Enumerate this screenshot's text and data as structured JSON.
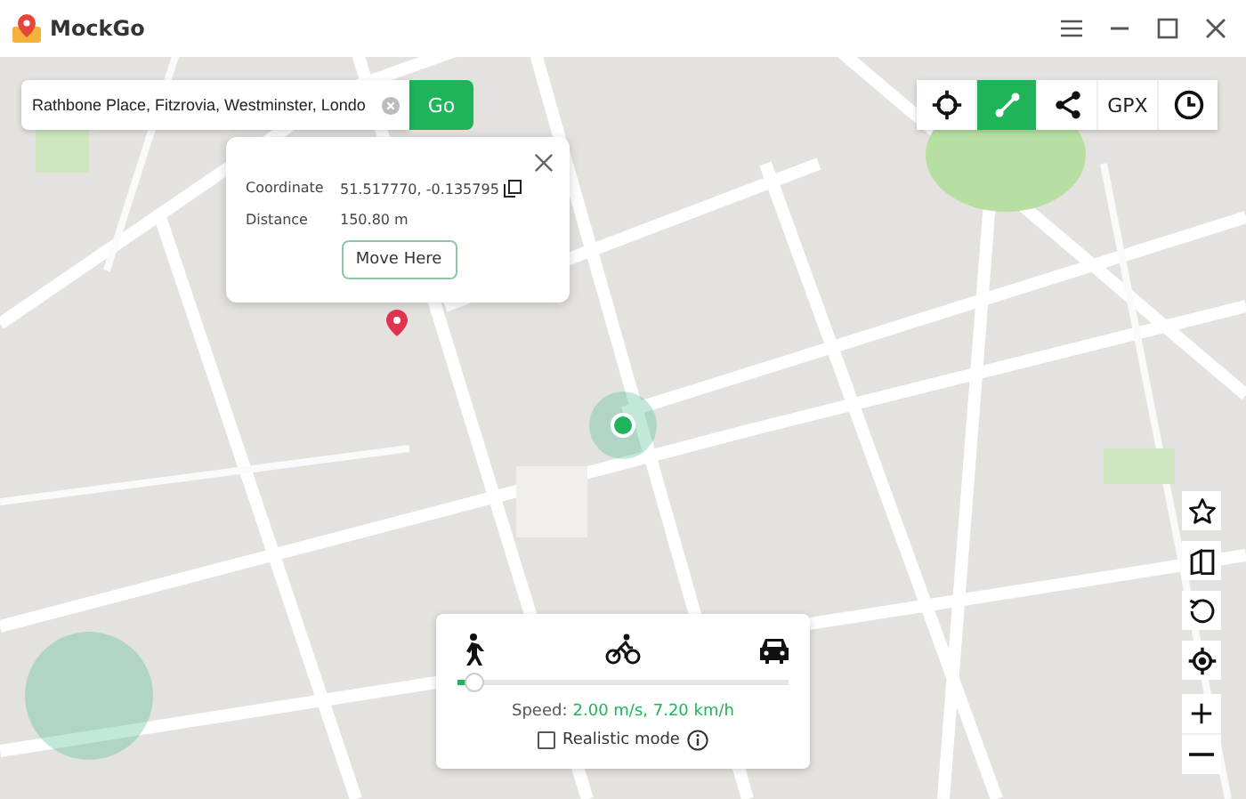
{
  "window": {
    "title": "MockGo"
  },
  "search": {
    "value": "Rathbone Place, Fitzrovia, Westminster, Londo",
    "button": "Go"
  },
  "toolbar": [
    {
      "kind": "crosshair",
      "selected": false
    },
    {
      "kind": "route",
      "selected": true
    },
    {
      "kind": "share",
      "selected": false
    },
    {
      "kind": "text",
      "label": "GPX",
      "selected": false
    },
    {
      "kind": "clock",
      "selected": false
    }
  ],
  "popup": {
    "rows": [
      {
        "label": "Coordinate",
        "value": "51.517770, -0.135795",
        "copy": true
      },
      {
        "label": "Distance",
        "value": "150.80 m",
        "copy": false
      }
    ],
    "button": "Move Here"
  },
  "speed_panel": {
    "modes": [
      {
        "kind": "walk"
      },
      {
        "kind": "bike"
      },
      {
        "kind": "car"
      }
    ],
    "level": 0.05,
    "speed_label": "Speed:",
    "speed_value": "2.00 m/s, 7.20 km/h",
    "realistic_mode": {
      "label": "Realistic mode",
      "checked": false
    }
  },
  "side_tools": [
    {
      "kind": "star"
    },
    {
      "kind": "book"
    },
    {
      "kind": "reset"
    },
    {
      "kind": "locate"
    }
  ],
  "zoom": [
    {
      "kind": "plus"
    },
    {
      "kind": "minus"
    }
  ]
}
